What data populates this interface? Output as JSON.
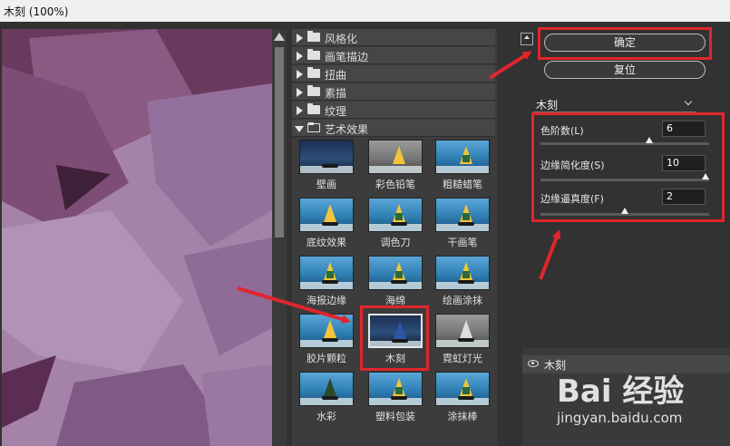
{
  "window": {
    "title": "木刻 (100%)"
  },
  "categories": [
    {
      "label": "风格化",
      "expanded": false
    },
    {
      "label": "画笔描边",
      "expanded": false
    },
    {
      "label": "扭曲",
      "expanded": false
    },
    {
      "label": "素描",
      "expanded": false
    },
    {
      "label": "纹理",
      "expanded": false
    },
    {
      "label": "艺术效果",
      "expanded": true
    }
  ],
  "thumbnails": [
    {
      "label": "壁画"
    },
    {
      "label": "彩色铅笔"
    },
    {
      "label": "粗糙蜡笔"
    },
    {
      "label": "底纹效果"
    },
    {
      "label": "调色刀"
    },
    {
      "label": "干画笔"
    },
    {
      "label": "海报边缘"
    },
    {
      "label": "海绵"
    },
    {
      "label": "绘画涂抹"
    },
    {
      "label": "胶片颗粒"
    },
    {
      "label": "木刻",
      "selected": true
    },
    {
      "label": "霓虹灯光"
    },
    {
      "label": "水彩"
    },
    {
      "label": "塑料包装"
    },
    {
      "label": "涂抹棒"
    }
  ],
  "buttons": {
    "ok": "确定",
    "reset": "复位"
  },
  "filter_select": {
    "value": "木刻"
  },
  "params": [
    {
      "label": "色阶数(L)",
      "value": "6",
      "level": 0.65
    },
    {
      "label": "边缘简化度(S)",
      "value": "10",
      "level": 1.0
    },
    {
      "label": "边缘逼真度(F)",
      "value": "2",
      "level": 0.5
    }
  ],
  "layers": [
    {
      "name": "木刻"
    }
  ],
  "watermark": {
    "brand": "Bai 经验",
    "url": "jingyan.baidu.com"
  },
  "colors": {
    "highlight": "#e0262c",
    "preview": "#a07aa5"
  }
}
